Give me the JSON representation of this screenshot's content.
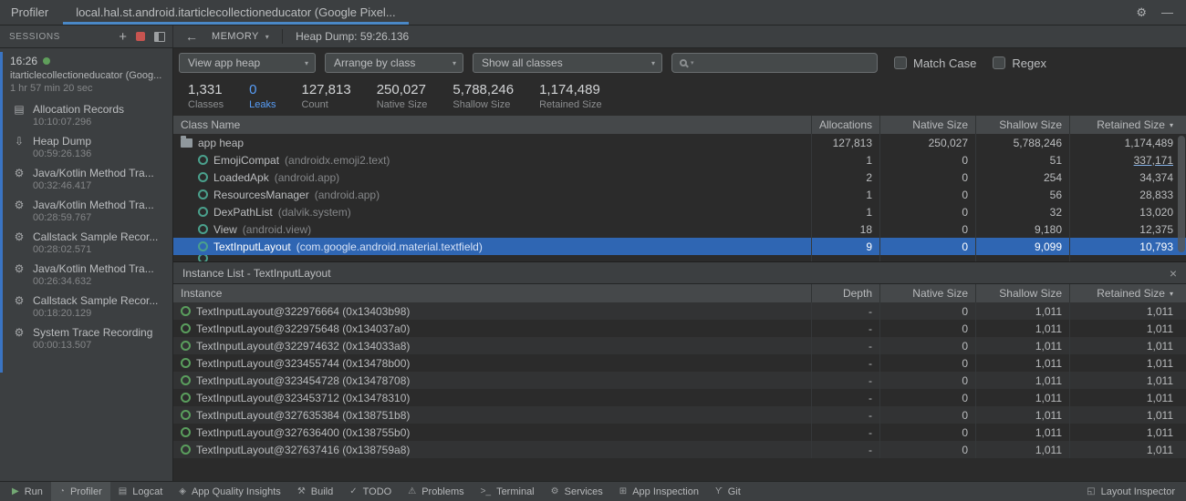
{
  "window": {
    "tool_label": "Profiler",
    "session_tab": "local.hal.st.android.itarticlecollectioneducator (Google Pixel..."
  },
  "icons": {
    "gear": "⚙",
    "minimize": "—",
    "back": "←",
    "caret": "▾",
    "sort": "▾",
    "close": "×",
    "add": "+"
  },
  "colors": {
    "accent_blue": "#589df6",
    "selection_blue": "#2f66b3",
    "tab_underline": "#4a88c7",
    "stop_red": "#c75450",
    "live_green": "#5f9e5b"
  },
  "sessions": {
    "title": "SESSIONS",
    "current": {
      "time": "16:26",
      "name": "itarticlecollectioneducator (Goog...",
      "duration": "1 hr 57 min 20 sec"
    },
    "items": [
      {
        "icon_name": "allocation-records-icon",
        "icon_glyph": "▤",
        "label": "Allocation Records",
        "time": "10:10:07.296"
      },
      {
        "icon_name": "heap-dump-icon",
        "icon_glyph": "⇩",
        "label": "Heap Dump",
        "time": "00:59:26.136"
      },
      {
        "icon_name": "method-trace-icon",
        "icon_glyph": "⚙",
        "label": "Java/Kotlin Method Tra...",
        "time": "00:32:46.417"
      },
      {
        "icon_name": "method-trace-icon",
        "icon_glyph": "⚙",
        "label": "Java/Kotlin Method Tra...",
        "time": "00:28:59.767"
      },
      {
        "icon_name": "callstack-sample-icon",
        "icon_glyph": "⚙",
        "label": "Callstack Sample Recor...",
        "time": "00:28:02.571"
      },
      {
        "icon_name": "method-trace-icon",
        "icon_glyph": "⚙",
        "label": "Java/Kotlin Method Tra...",
        "time": "00:26:34.632"
      },
      {
        "icon_name": "callstack-sample-icon",
        "icon_glyph": "⚙",
        "label": "Callstack Sample Recor...",
        "time": "00:18:20.129"
      },
      {
        "icon_name": "system-trace-icon",
        "icon_glyph": "⚙",
        "label": "System Trace Recording",
        "time": "00:00:13.507"
      }
    ]
  },
  "toolbar": {
    "memory_label": "MEMORY",
    "heap_label": "Heap Dump: 59:26.136",
    "view_value": "View app heap",
    "arrange_value": "Arrange by class",
    "show_value": "Show all classes",
    "match_case_label": "Match Case",
    "regex_label": "Regex"
  },
  "stats": [
    {
      "value": "1,331",
      "label": "Classes"
    },
    {
      "value": "0",
      "label": "Leaks",
      "accent": true
    },
    {
      "value": "127,813",
      "label": "Count"
    },
    {
      "value": "250,027",
      "label": "Native Size"
    },
    {
      "value": "5,788,246",
      "label": "Shallow Size"
    },
    {
      "value": "1,174,489",
      "label": "Retained Size"
    }
  ],
  "class_table": {
    "headers": [
      "Class Name",
      "Allocations",
      "Native Size",
      "Shallow Size",
      "Retained Size"
    ],
    "rows": [
      {
        "name": "app heap",
        "pkg": "",
        "alloc": "127,813",
        "native": "250,027",
        "shallow": "5,788,246",
        "retained": "1,174,489"
      },
      {
        "name": "EmojiCompat",
        "pkg": "(androidx.emoji2.text)",
        "alloc": "1",
        "native": "0",
        "shallow": "51",
        "retained": "337,171"
      },
      {
        "name": "LoadedApk",
        "pkg": "(android.app)",
        "alloc": "2",
        "native": "0",
        "shallow": "254",
        "retained": "34,374"
      },
      {
        "name": "ResourcesManager",
        "pkg": "(android.app)",
        "alloc": "1",
        "native": "0",
        "shallow": "56",
        "retained": "28,833"
      },
      {
        "name": "DexPathList",
        "pkg": "(dalvik.system)",
        "alloc": "1",
        "native": "0",
        "shallow": "32",
        "retained": "13,020"
      },
      {
        "name": "View",
        "pkg": "(android.view)",
        "alloc": "18",
        "native": "0",
        "shallow": "9,180",
        "retained": "12,375"
      },
      {
        "name": "TextInputLayout",
        "pkg": "(com.google.android.material.textfield)",
        "alloc": "9",
        "native": "0",
        "shallow": "9,099",
        "retained": "10,793"
      }
    ]
  },
  "instance_panel": {
    "title": "Instance List - TextInputLayout",
    "headers": [
      "Instance",
      "Depth",
      "Native Size",
      "Shallow Size",
      "Retained Size"
    ],
    "rows": [
      {
        "name": "TextInputLayout@322976664 (0x13403b98)",
        "depth": "-",
        "native": "0",
        "shallow": "1,011",
        "retained": "1,011"
      },
      {
        "name": "TextInputLayout@322975648 (0x134037a0)",
        "depth": "-",
        "native": "0",
        "shallow": "1,011",
        "retained": "1,011"
      },
      {
        "name": "TextInputLayout@322974632 (0x134033a8)",
        "depth": "-",
        "native": "0",
        "shallow": "1,011",
        "retained": "1,011"
      },
      {
        "name": "TextInputLayout@323455744 (0x13478b00)",
        "depth": "-",
        "native": "0",
        "shallow": "1,011",
        "retained": "1,011"
      },
      {
        "name": "TextInputLayout@323454728 (0x13478708)",
        "depth": "-",
        "native": "0",
        "shallow": "1,011",
        "retained": "1,011"
      },
      {
        "name": "TextInputLayout@323453712 (0x13478310)",
        "depth": "-",
        "native": "0",
        "shallow": "1,011",
        "retained": "1,011"
      },
      {
        "name": "TextInputLayout@327635384 (0x138751b8)",
        "depth": "-",
        "native": "0",
        "shallow": "1,011",
        "retained": "1,011"
      },
      {
        "name": "TextInputLayout@327636400 (0x138755b0)",
        "depth": "-",
        "native": "0",
        "shallow": "1,011",
        "retained": "1,011"
      },
      {
        "name": "TextInputLayout@327637416 (0x138759a8)",
        "depth": "-",
        "native": "0",
        "shallow": "1,011",
        "retained": "1,011"
      }
    ]
  },
  "statusbar": {
    "items": [
      {
        "icon_name": "run-icon",
        "icon_glyph": "▶",
        "label": "Run",
        "accent": true
      },
      {
        "icon_name": "profiler-icon",
        "icon_glyph": "◔",
        "label": "Profiler",
        "selected": true
      },
      {
        "icon_name": "logcat-icon",
        "icon_glyph": "▤",
        "label": "Logcat"
      },
      {
        "icon_name": "app-quality-insights-icon",
        "icon_glyph": "◈",
        "label": "App Quality Insights"
      },
      {
        "icon_name": "build-icon",
        "icon_glyph": "⚒",
        "label": "Build"
      },
      {
        "icon_name": "todo-icon",
        "icon_glyph": "✓",
        "label": "TODO"
      },
      {
        "icon_name": "problems-icon",
        "icon_glyph": "⚠",
        "label": "Problems"
      },
      {
        "icon_name": "terminal-icon",
        "icon_glyph": ">_",
        "label": "Terminal"
      },
      {
        "icon_name": "services-icon",
        "icon_glyph": "⚙",
        "label": "Services"
      },
      {
        "icon_name": "app-inspection-icon",
        "icon_glyph": "⊞",
        "label": "App Inspection"
      },
      {
        "icon_name": "git-icon",
        "icon_glyph": "ϒ",
        "label": "Git"
      }
    ],
    "right": {
      "icon_glyph": "◱",
      "label": "Layout Inspector"
    }
  }
}
